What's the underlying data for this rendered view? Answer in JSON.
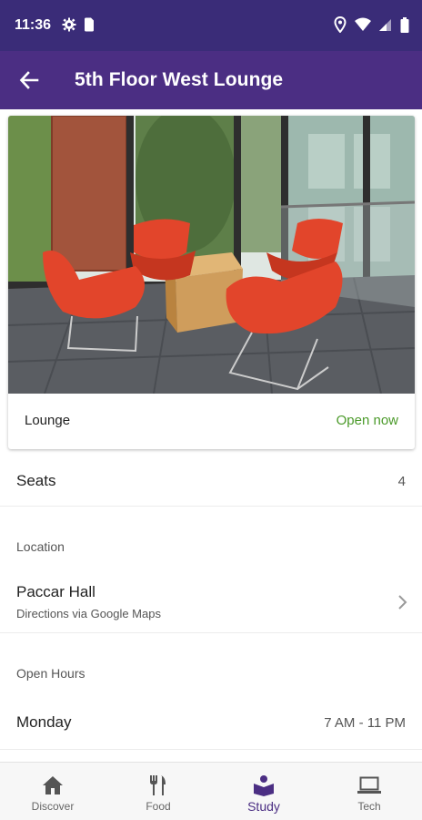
{
  "status_bar": {
    "time": "11:36"
  },
  "header": {
    "title": "5th Floor West Lounge"
  },
  "card": {
    "type": "Lounge",
    "status": "Open now",
    "status_color": "#4b9a2a"
  },
  "seats": {
    "label": "Seats",
    "value": "4"
  },
  "location": {
    "section_label": "Location",
    "name": "Paccar Hall",
    "subtitle": "Directions via Google Maps"
  },
  "hours": {
    "section_label": "Open Hours",
    "rows": [
      {
        "day": "Monday",
        "time": "7 AM - 11 PM"
      }
    ]
  },
  "bottom_nav": {
    "items": [
      {
        "label": "Discover",
        "icon": "home-icon"
      },
      {
        "label": "Food",
        "icon": "utensils-icon"
      },
      {
        "label": "Study",
        "icon": "book-reader-icon",
        "active": true
      },
      {
        "label": "Tech",
        "icon": "laptop-icon"
      }
    ]
  },
  "colors": {
    "status_bar": "#3a2c78",
    "app_bar": "#4b2e83",
    "accent": "#4b2e83"
  }
}
